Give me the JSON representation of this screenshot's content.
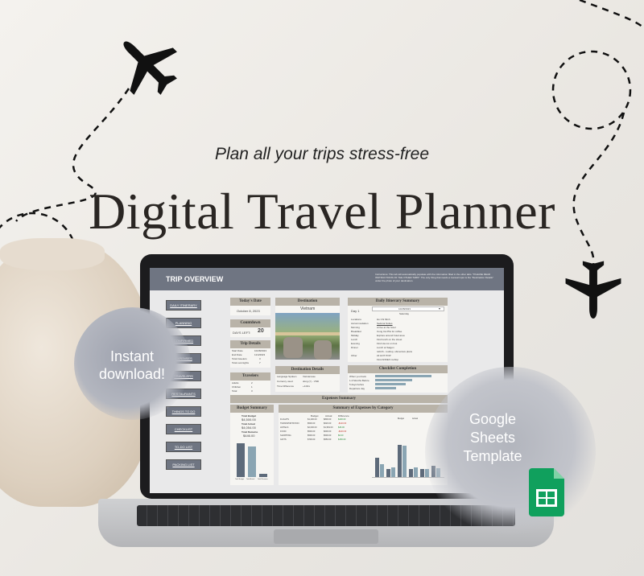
{
  "hero": {
    "tagline": "Plan all your trips stress-free",
    "title": "Digital Travel Planner"
  },
  "badges": {
    "instant": "Instant download!",
    "template": "Google Sheets Template",
    "sheets_icon": "google-sheets-icon"
  },
  "sheet": {
    "title": "TRIP OVERVIEW",
    "instructions": "Instructions: This tab will automatically populate with the information filled in the other tabs. *PLEASE READ INSTRUCTIONS OF THE OTHER TABS*. The only thing that needs a manual input is the \"Destination Details\" under the photo of your destination.",
    "nav": [
      "DAILY ITINERARY",
      "PLANNING",
      "CONFIRMED",
      "EXPENSES",
      "TRAVELERS",
      "RESTAURANTS",
      "THINGS TO DO",
      "CHECKLIST",
      "TO-DO LIST",
      "PACKING LIST"
    ],
    "today": {
      "header": "Today's Date",
      "value": "October 8, 2023"
    },
    "countdown": {
      "header": "Countdown",
      "label": "DAYS LEFT:",
      "value": "20"
    },
    "trip_details": {
      "header": "Trip Details",
      "rows": [
        {
          "k": "Start Date",
          "v": "10/28/2023"
        },
        {
          "k": "End Date",
          "v": "11/4/2023"
        },
        {
          "k": "Total travelers",
          "v": "3"
        },
        {
          "k": "Total overnights",
          "v": "7"
        }
      ]
    },
    "travelers": {
      "header": "Travelers",
      "rows": [
        {
          "k": "Adults",
          "v": "2"
        },
        {
          "k": "Children",
          "v": "1"
        },
        {
          "k": "Total",
          "v": "3"
        }
      ]
    },
    "destination": {
      "header": "Destination",
      "value": "Vietnam"
    },
    "destination_details": {
      "header": "Destination Details",
      "rows": [
        {
          "k": "Language Spoken",
          "v": "Vietnamese"
        },
        {
          "k": "Currency used",
          "v": "dong (₫) - VND"
        },
        {
          "k": "Time Difference",
          "v": "+11hrs"
        }
      ]
    },
    "itinerary": {
      "header": "Daily Itinerary Summary",
      "day": "Day 1",
      "date": "10/28/2023",
      "weekday": "Saturday",
      "rows": [
        {
          "k": "Locations",
          "v": "Ho Chi Minh"
        },
        {
          "k": "Accommodation",
          "v": "Sedona Suites"
        },
        {
          "k": "Morning",
          "v": "Arrive at the hotel"
        },
        {
          "k": "Breakfast",
          "v": "Cong Cà Phê for coffee"
        },
        {
          "k": "Midday",
          "v": "Explore around hotel area"
        },
        {
          "k": "Lunch",
          "v": "Find lunch on the street"
        },
        {
          "k": "Evening",
          "v": "Find Ha noi on foot"
        },
        {
          "k": "Dinner",
          "v": "Lunch at Saigon"
        },
        {
          "k": "",
          "v": "rebirth - rooftop, ubmersive plans"
        },
        {
          "k": "Other",
          "v": "22 HOT POP"
        },
        {
          "k": "",
          "v": "Find ANNEX rooftop"
        }
      ]
    },
    "checklist": {
      "header": "Checklist Completion",
      "rows": [
        {
          "k": "When you book",
          "pct": 0.85
        },
        {
          "k": "1-3 Months Before",
          "pct": 0.55
        },
        {
          "k": "5 days before",
          "pct": 0.45
        },
        {
          "k": "Departure day",
          "pct": 0.3
        }
      ]
    },
    "expenses": {
      "header": "Expenses Summary",
      "budget_header": "Budget Summary",
      "total_budget_label": "Total Budget",
      "total_budget": "$4,500.00",
      "total_actual_label": "Total Actual",
      "total_actual": "$4,054.00",
      "total_remaining_label": "Total Remains",
      "total_remaining": "$446.00",
      "by_category_header": "Summary of Expenses by Category",
      "col_budget": "Budget",
      "col_actual": "Actual",
      "col_diff": "Difference",
      "rows": [
        {
          "cat": "FLIGHTS",
          "b": "$1,200.00",
          "a": "$800.00",
          "d": "$400.00"
        },
        {
          "cat": "TRANSPORTATION",
          "b": "$500.00",
          "a": "$620.00",
          "d": "-$120.00"
        },
        {
          "cat": "HOTELS",
          "b": "$2,000.00",
          "a": "$1,954.00",
          "d": "$46.00"
        },
        {
          "cat": "FOOD",
          "b": "$500.00",
          "a": "$600.00",
          "d": "-$100.00"
        },
        {
          "cat": "SHOPPING",
          "b": "$500.00",
          "a": "$500.00",
          "d": "$0.00"
        },
        {
          "cat": "GIFTS",
          "b": "$700.00",
          "a": "$550.00",
          "d": "$150.00"
        }
      ],
      "bar_labels": [
        "Total Budget",
        "Total Actual",
        "Total Remains"
      ],
      "budget_bars": [
        4500,
        4054,
        446
      ],
      "category_chart": {
        "legend": [
          "Budget",
          "Actual"
        ],
        "budget": [
          1200,
          500,
          2000,
          500,
          500,
          700
        ],
        "actual": [
          800,
          620,
          1954,
          600,
          500,
          550
        ]
      }
    }
  },
  "colors": {
    "header": "#6f7582",
    "card_header": "#b9b3a8",
    "bar_dark": "#5d6a7a",
    "bar_light": "#8aa5b3",
    "sheets_green": "#10a05d"
  },
  "icons": [
    "airplane-icon",
    "dashed-flight-path"
  ]
}
